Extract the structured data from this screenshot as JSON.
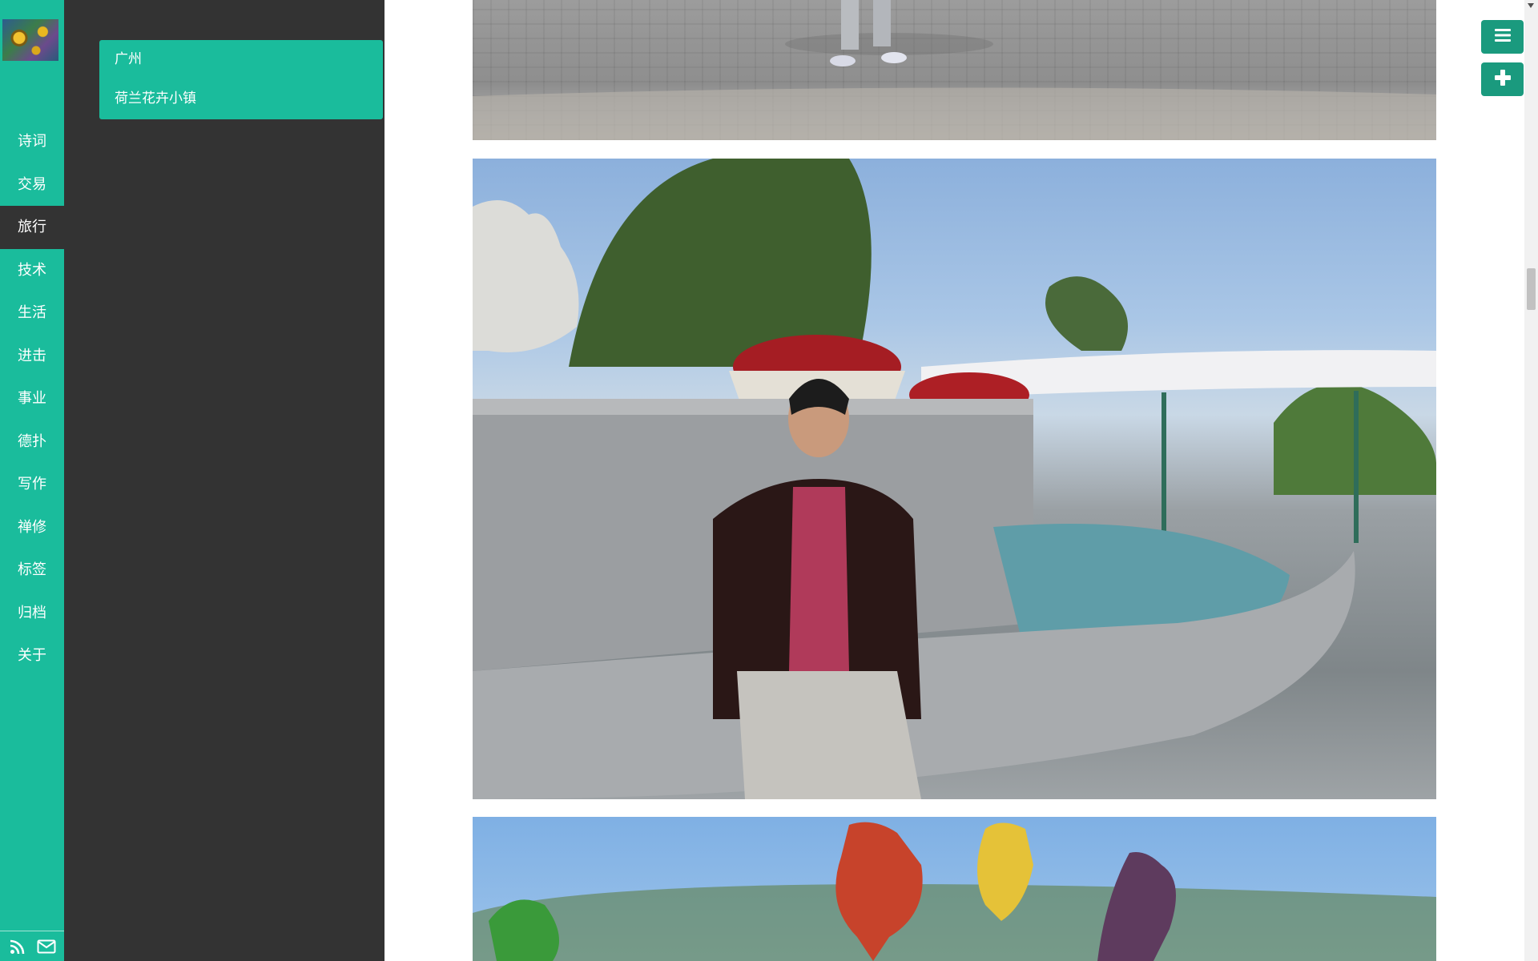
{
  "sidebar": {
    "avatar_icon": "sunflower-avatar",
    "items": [
      {
        "label": "诗词"
      },
      {
        "label": "交易"
      },
      {
        "label": "旅行"
      },
      {
        "label": "技术"
      },
      {
        "label": "生活"
      },
      {
        "label": "进击"
      },
      {
        "label": "事业"
      },
      {
        "label": "德扑"
      },
      {
        "label": "写作"
      },
      {
        "label": "禅修"
      },
      {
        "label": "标签"
      },
      {
        "label": "归档"
      },
      {
        "label": "关于"
      }
    ],
    "active_item": "旅行",
    "footer_icons": [
      "rss-icon",
      "mail-icon"
    ]
  },
  "submenu": {
    "items": [
      {
        "label": "广州"
      },
      {
        "label": "荷兰花卉小镇"
      }
    ]
  },
  "toolbar": {
    "menu_icon": "hamburger-menu-icon",
    "add_icon": "plus-icon"
  },
  "colors": {
    "accent": "#1abc9c",
    "panel": "#333333",
    "button": "#1a9a7e"
  }
}
